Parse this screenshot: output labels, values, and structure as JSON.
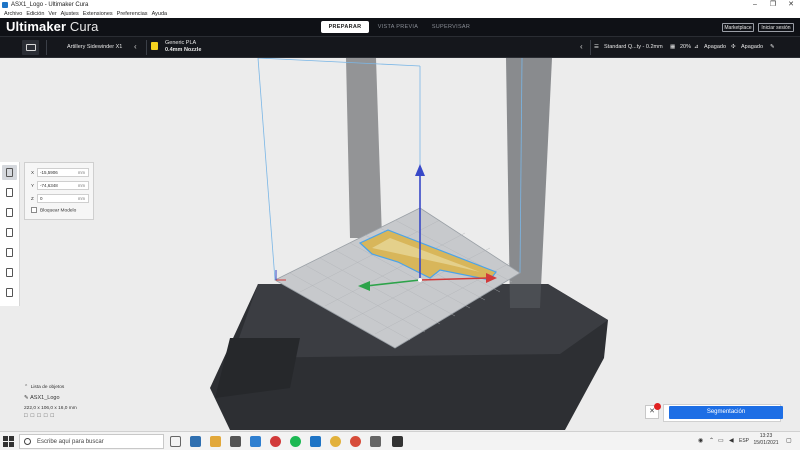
{
  "window": {
    "title": "ASX1_Logo - Ultimaker Cura",
    "controls": [
      "–",
      "❐",
      "✕"
    ]
  },
  "menu": [
    "Archivo",
    "Edición",
    "Ver",
    "Ajustes",
    "Extensiones",
    "Preferencias",
    "Ayuda"
  ],
  "header": {
    "brand_bold": "Ultimaker",
    "brand_light": "Cura",
    "tabs": [
      "PREPARAR",
      "VISTA PREVIA",
      "SUPERVISAR"
    ],
    "active_tab": 0,
    "marketplace": "Marketplace",
    "signin": "Iniciar sesión"
  },
  "toolbar": {
    "printer": "Artillery Sidewinder X1",
    "material_line1": "Generic PLA",
    "material_line2": "0.4mm Nozzle",
    "profile": "Standard Q...ty - 0.2mm",
    "infill": "20%",
    "support": "Apagado",
    "adhesion": "Apagado"
  },
  "move_panel": {
    "x_label": "X",
    "x_value": "-15,5906",
    "y_label": "Y",
    "y_value": "-74,6348",
    "z_label": "Z",
    "z_value": "0",
    "unit": "mm",
    "lock_label": "Bloquear Modelo"
  },
  "object_list": {
    "header": "Lista de objetos",
    "name": "ASX1_Logo",
    "dimensions": "222,0 x 106,0 x 16,0 mm"
  },
  "slice_button": "Segmentación",
  "taskbar": {
    "search_placeholder": "Escribe aquí para buscar",
    "language": "ESP",
    "time": "13:23",
    "date": "15/01/2021"
  },
  "colors": {
    "accent": "#1d6ee5",
    "header_bg": "#0f1116",
    "material_badge": "#f4d21f"
  }
}
